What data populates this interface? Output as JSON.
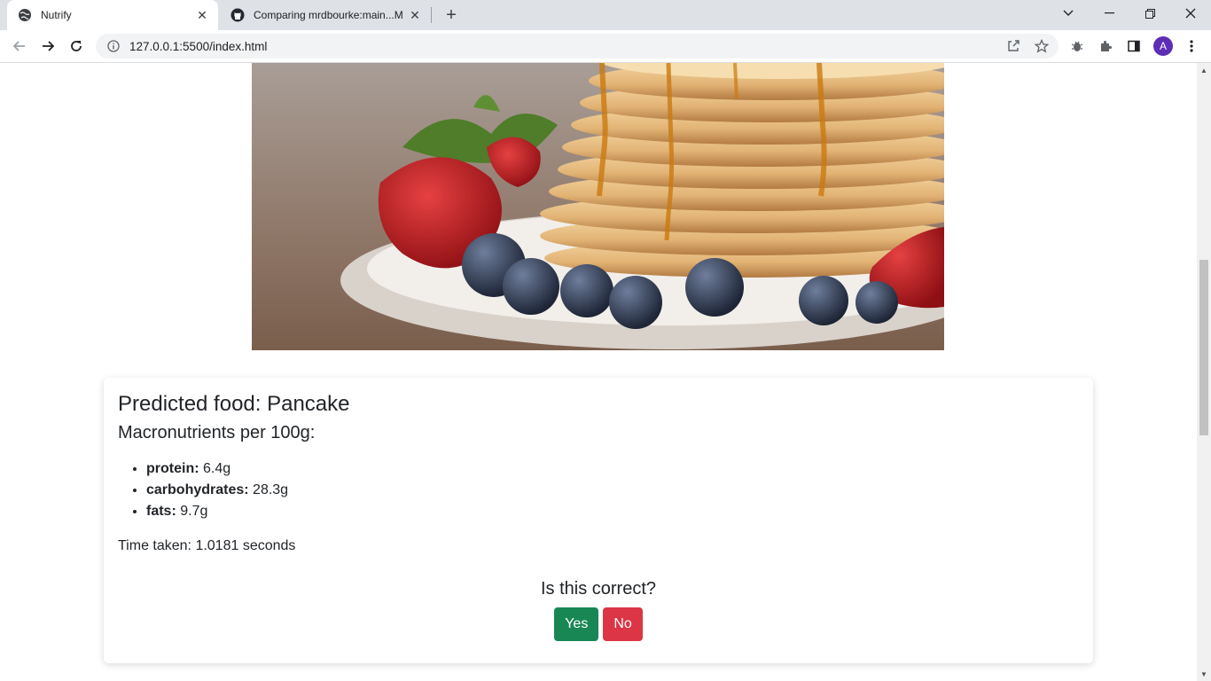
{
  "browser": {
    "tabs": [
      {
        "title": "Nutrify"
      },
      {
        "title": "Comparing mrdbourke:main...M"
      }
    ],
    "url": "127.0.0.1:5500/index.html",
    "profile_initial": "A"
  },
  "result": {
    "predicted_label": "Predicted food: Pancake",
    "macros_heading": "Macronutrients per 100g:",
    "macros": [
      {
        "name": "protein:",
        "value": " 6.4g"
      },
      {
        "name": "carbohydrates:",
        "value": " 28.3g"
      },
      {
        "name": "fats:",
        "value": " 9.7g"
      }
    ],
    "time_taken": "Time taken: 1.0181 seconds"
  },
  "feedback": {
    "question": "Is this correct?",
    "yes_label": "Yes",
    "no_label": "No"
  },
  "colors": {
    "yes": "#198754",
    "no": "#dc3545",
    "avatar": "#5c2db5"
  },
  "icons": {
    "tab1": "globe-icon",
    "tab2": "github-icon"
  }
}
